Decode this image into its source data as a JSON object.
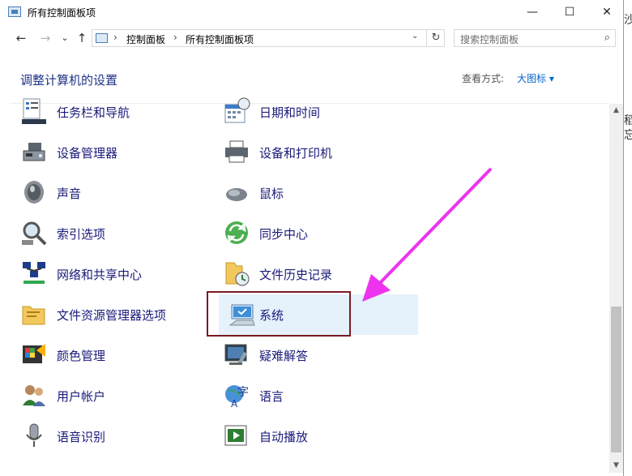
{
  "window": {
    "title": "所有控制面板项",
    "minimize": "—",
    "maximize": "☐",
    "close": "✕"
  },
  "address": {
    "back": "←",
    "forward": "→",
    "recent": "⌄",
    "up": "↑",
    "crumbs": [
      "控制面板",
      "所有控制面板项"
    ],
    "sep": "›",
    "dropdown": "⌄",
    "refresh": "↻",
    "search_placeholder": "搜索控制面板",
    "search_icon": "⌕"
  },
  "header": {
    "title": "调整计算机的设置",
    "view_label": "查看方式:",
    "view_value": "大图标 ▾"
  },
  "items": [
    {
      "label": "任务栏和导航",
      "icon": "taskbar-icon"
    },
    {
      "label": "日期和时间",
      "icon": "calendar-clock-icon"
    },
    {
      "label": "设备管理器",
      "icon": "device-manager-icon"
    },
    {
      "label": "设备和打印机",
      "icon": "printer-icon"
    },
    {
      "label": "声音",
      "icon": "speaker-icon"
    },
    {
      "label": "鼠标",
      "icon": "mouse-icon"
    },
    {
      "label": "索引选项",
      "icon": "magnifier-icon"
    },
    {
      "label": "同步中心",
      "icon": "sync-icon"
    },
    {
      "label": "网络和共享中心",
      "icon": "network-icon"
    },
    {
      "label": "文件历史记录",
      "icon": "file-history-icon"
    },
    {
      "label": "文件资源管理器选项",
      "icon": "folder-options-icon"
    },
    {
      "label": "系统",
      "icon": "system-monitor-icon"
    },
    {
      "label": "颜色管理",
      "icon": "color-management-icon"
    },
    {
      "label": "疑难解答",
      "icon": "troubleshoot-icon"
    },
    {
      "label": "用户帐户",
      "icon": "user-accounts-icon"
    },
    {
      "label": "语言",
      "icon": "language-icon"
    },
    {
      "label": "语音识别",
      "icon": "microphone-icon"
    },
    {
      "label": "自动播放",
      "icon": "autoplay-icon"
    }
  ],
  "background_chars": [
    "沙",
    "稻",
    "忘"
  ],
  "colors": {
    "link_text": "#1a1a7a",
    "heading": "#1e3287",
    "highlight_box": "#7b1a23",
    "arrow": "#ee33ee",
    "selected_bg": "#e5f1fb"
  }
}
